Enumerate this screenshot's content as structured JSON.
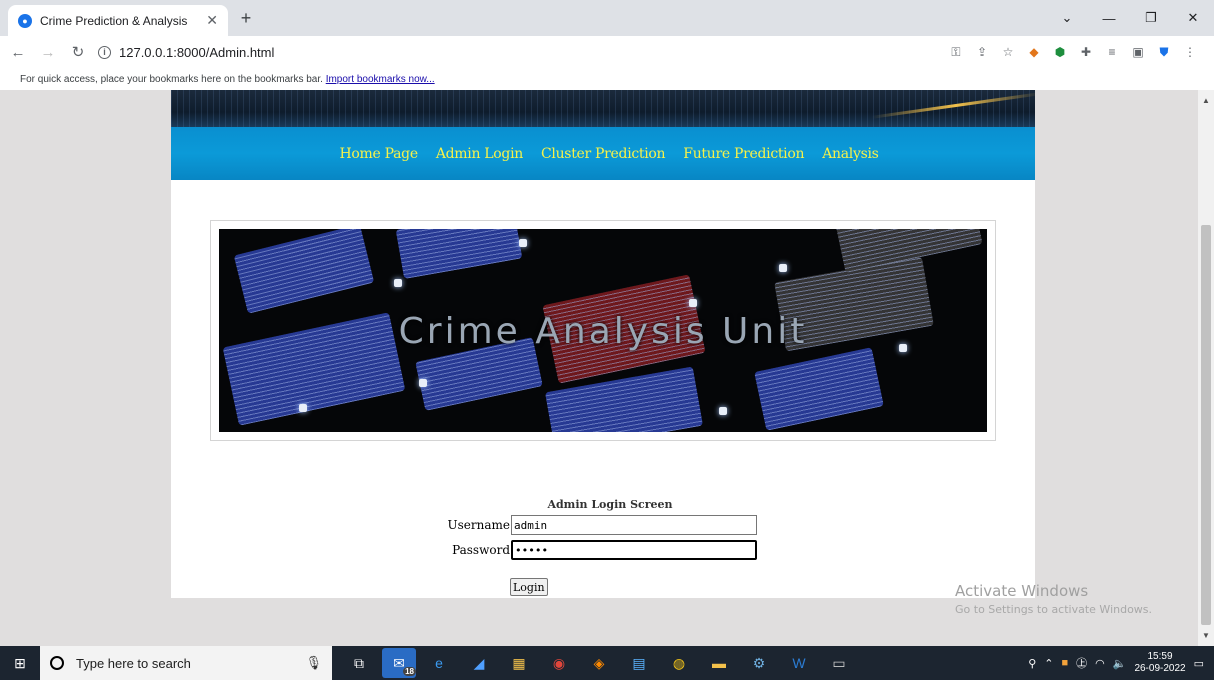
{
  "browser": {
    "tab_title": "Crime Prediction & Analysis",
    "tab_close": "✕",
    "new_tab": "+",
    "url": "127.0.0.1:8000/Admin.html",
    "bookmarks_text": "For quick access, place your bookmarks here on the bookmarks bar.",
    "bookmarks_link": "Import bookmarks now..."
  },
  "site": {
    "nav": [
      "Home Page",
      "Admin Login",
      "Cluster Prediction",
      "Future Prediction",
      "Analysis"
    ],
    "banner_title": "Crime Analysis Unit"
  },
  "login": {
    "title": "Admin Login Screen",
    "username_label": "Username",
    "username_value": "admin",
    "password_label": "Password",
    "password_value": "•••••",
    "button_label": "Login"
  },
  "watermark": {
    "line1": "Activate Windows",
    "line2": "Go to Settings to activate Windows."
  },
  "taskbar": {
    "search_placeholder": "Type here to search",
    "badge_count": "18",
    "time": "15:59",
    "date": "26-09-2022"
  }
}
